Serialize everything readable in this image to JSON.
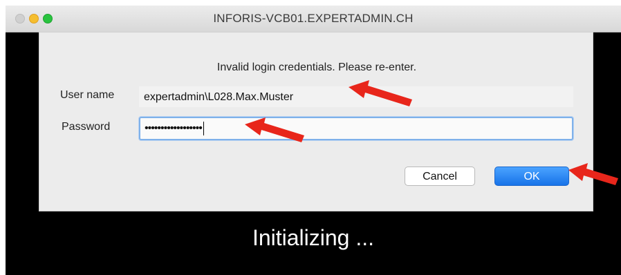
{
  "window": {
    "title": "INFORIS-VCB01.EXPERTADMIN.CH"
  },
  "dialog": {
    "message": "Invalid login credentials. Please re-enter.",
    "username_label": "User name",
    "username_value": "expertadmin\\L028.Max.Muster",
    "password_label": "Password",
    "password_value": "••••••••••••••••••",
    "cancel_label": "Cancel",
    "ok_label": "OK"
  },
  "status_text": "Initializing ...",
  "colors": {
    "annotation_arrow": "#e8261b",
    "ok_button": "#1873e8",
    "focus_ring": "#7fb1ea"
  }
}
